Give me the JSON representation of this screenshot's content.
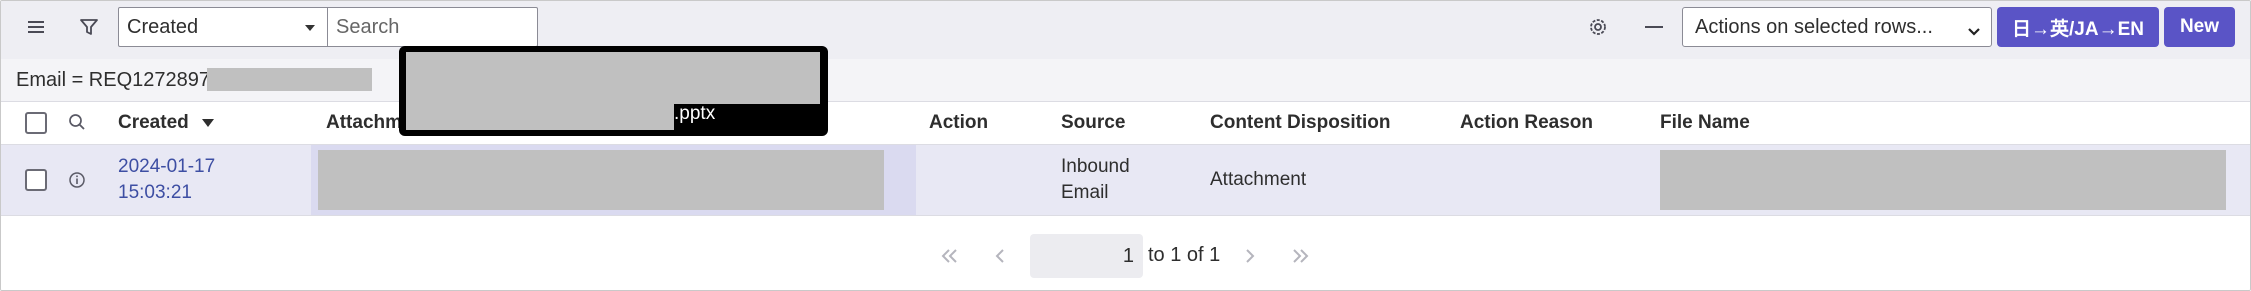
{
  "toolbar": {
    "field_select": "Created",
    "search_placeholder": "Search",
    "actions_select": "Actions on selected rows...",
    "translate_label": "日→英/JA→EN",
    "new_label": "New"
  },
  "filter": {
    "breadcrumb": "Email = REQ1272897_"
  },
  "columns": {
    "created": "Created",
    "attachment": "Attachm",
    "action": "Action",
    "source": "Source",
    "content_disposition": "Content Disposition",
    "action_reason": "Action Reason",
    "file_name": "File Name"
  },
  "rows": [
    {
      "created_date": "2024-01-17",
      "created_time": "15:03:21",
      "source_line1": "Inbound",
      "source_line2": "Email",
      "content_disposition": "Attachment"
    }
  ],
  "popup": {
    "extension": ".pptx"
  },
  "pagination": {
    "current_page": "1",
    "summary": "to 1 of 1"
  },
  "colors": {
    "accent": "#5a54c6",
    "link": "#3d4ea3",
    "row_highlight": "#e8e8f4"
  },
  "icons": [
    "menu-icon",
    "filter-icon",
    "gear-icon",
    "minus-icon",
    "search-icon",
    "info-icon",
    "sort-desc-icon",
    "first-page-icon",
    "prev-page-icon",
    "next-page-icon",
    "last-page-icon"
  ]
}
